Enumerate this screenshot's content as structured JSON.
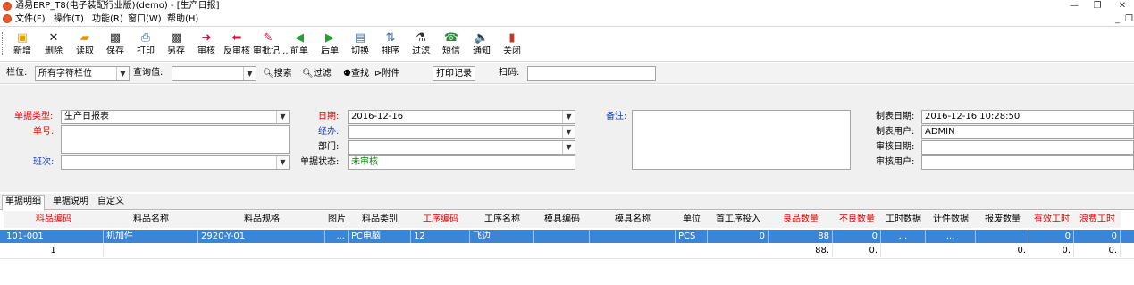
{
  "window": {
    "title": "通易ERP_T8(电子装配行业版)(demo) - [生产日报]",
    "minimize": "—",
    "restore": "❐",
    "close_glyph": "✕"
  },
  "menu": {
    "items": [
      "文件(F)",
      "操作(T)",
      "功能(R)",
      "窗口(W)",
      "帮助(H)"
    ],
    "mdi_min": "_",
    "mdi_restore": "❐"
  },
  "toolbar": {
    "buttons": [
      {
        "label": "新增",
        "icon": "new-icon",
        "glyph": "▣",
        "color": "#e0a300"
      },
      {
        "label": "删除",
        "icon": "delete-icon",
        "glyph": "✕",
        "color": "#222222"
      },
      {
        "label": "读取",
        "icon": "open-folder-icon",
        "glyph": "▰",
        "color": "#e69a1e"
      },
      {
        "label": "保存",
        "icon": "save-icon",
        "glyph": "▩",
        "color": "#333333"
      },
      {
        "label": "打印",
        "icon": "printer-icon",
        "glyph": "⎙",
        "color": "#3a6fb0"
      },
      {
        "label": "另存",
        "icon": "save-as-icon",
        "glyph": "▩",
        "color": "#333333"
      },
      {
        "label": "审核",
        "icon": "approve-arrow-icon",
        "glyph": "➜",
        "color": "#d0103a"
      },
      {
        "label": "反审核",
        "icon": "unapprove-arrow-icon",
        "glyph": "⬅",
        "color": "#d0103a"
      },
      {
        "label": "审批记...",
        "icon": "approval-record-icon",
        "glyph": "✎",
        "color": "#d0103a"
      },
      {
        "label": "前单",
        "icon": "previous-icon",
        "glyph": "◀",
        "color": "#2a9a3a"
      },
      {
        "label": "后单",
        "icon": "next-icon",
        "glyph": "▶",
        "color": "#2a9a3a"
      },
      {
        "label": "切换",
        "icon": "switch-icon",
        "glyph": "▤",
        "color": "#3a7fbf"
      },
      {
        "label": "排序",
        "icon": "sort-icon",
        "glyph": "⇅",
        "color": "#3a6fb0"
      },
      {
        "label": "过滤",
        "icon": "filter-icon",
        "glyph": "⚗",
        "color": "#333333"
      },
      {
        "label": "短信",
        "icon": "sms-icon",
        "glyph": "☎",
        "color": "#2a8a3a"
      },
      {
        "label": "通知",
        "icon": "notify-speaker-icon",
        "glyph": "🔈",
        "color": "#333333"
      },
      {
        "label": "关闭",
        "icon": "close-door-icon",
        "glyph": "▮",
        "color": "#c0392b"
      }
    ]
  },
  "filterbar": {
    "column_label": "栏位:",
    "column_value": "所有字符栏位",
    "query_label": "查询值:",
    "query_value": "",
    "search_btn": "搜索",
    "filter_btn": "过滤",
    "find_btn": "查找",
    "attach_btn": "附件",
    "print_log_btn": "打印记录",
    "scan_label": "扫码:",
    "scan_value": ""
  },
  "form": {
    "doc_type_label": "单据类型:",
    "doc_type_value": "生产日报表",
    "doc_no_label": "单号:",
    "doc_no_value": "",
    "shift_label": "班次:",
    "shift_value": "",
    "date_label": "日期:",
    "date_value": "2016-12-16",
    "handler_label": "经办:",
    "handler_value": "",
    "dept_label": "部门:",
    "dept_value": "",
    "status_label": "单据状态:",
    "status_value": "未审核",
    "remark_label": "备注:",
    "remark_value": "",
    "created_date_label": "制表日期:",
    "created_date_value": "2016-12-16 10:28:50",
    "created_user_label": "制表用户:",
    "created_user_value": "ADMIN",
    "review_date_label": "审核日期:",
    "review_date_value": "",
    "review_user_label": "审核用户:",
    "review_user_value": ""
  },
  "tabs": [
    "单据明细",
    "单据说明",
    "自定义"
  ],
  "grid": {
    "headers": [
      "料品编码",
      "料品名称",
      "料品规格",
      "图片",
      "料品类别",
      "工序编码",
      "工序名称",
      "模具编码",
      "模具名称",
      "单位",
      "首工序投入",
      "良品数量",
      "不良数量",
      "工时数据",
      "计件数据",
      "报废数量",
      "有效工时",
      "浪费工时"
    ],
    "row": {
      "code": "101-001",
      "name": "机加件",
      "spec": "2920-Y-01",
      "image": "...",
      "category": "PC电脑",
      "proc_code": "12",
      "proc_name": "飞边",
      "mold_code": "",
      "mold_name": "",
      "unit": "PCS",
      "first_input": "0",
      "good_qty": "88",
      "bad_qty": "0",
      "hours_data": "...",
      "piece_data": "...",
      "scrap_qty": "",
      "valid_hours": "0",
      "waste_hours": "0"
    },
    "summary": {
      "count": "1",
      "good_qty": "88.",
      "bad_qty": "0.",
      "scrap_qty": "0.",
      "valid_hours": "0.",
      "waste_hours": "0."
    }
  }
}
